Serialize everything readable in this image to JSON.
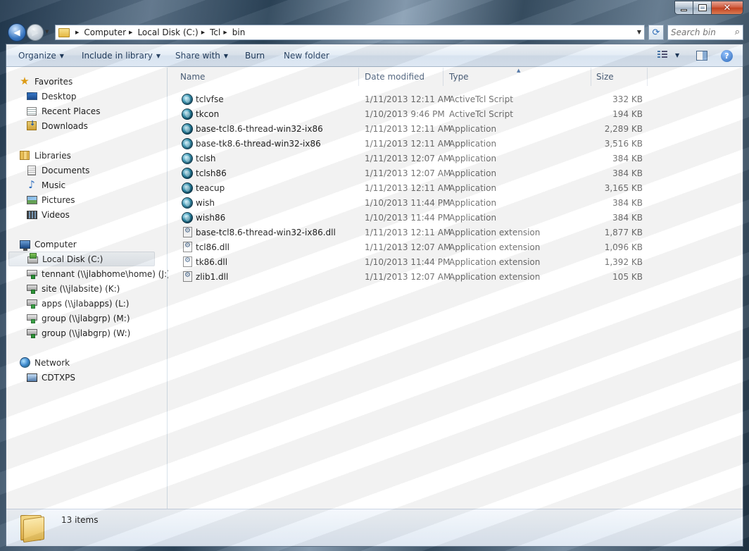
{
  "window": {
    "caption_buttons": {
      "minimize": "minimize-icon",
      "maximize": "maximize-icon",
      "close": "close-icon"
    }
  },
  "address": {
    "crumbs": [
      "Computer",
      "Local Disk (C:)",
      "Tcl",
      "bin"
    ]
  },
  "search": {
    "placeholder": "Search bin"
  },
  "toolbar": {
    "organize": "Organize",
    "include_in_library": "Include in library",
    "share_with": "Share with",
    "burn": "Burn",
    "new_folder": "New folder"
  },
  "nav": {
    "favorites": {
      "label": "Favorites",
      "items": [
        "Desktop",
        "Recent Places",
        "Downloads"
      ]
    },
    "libraries": {
      "label": "Libraries",
      "items": [
        "Documents",
        "Music",
        "Pictures",
        "Videos"
      ]
    },
    "computer": {
      "label": "Computer",
      "items": [
        "Local Disk (C:)",
        "tennant (\\\\jlabhome\\home) (J:)",
        "site (\\\\jlabsite) (K:)",
        "apps (\\\\jlabapps) (L:)",
        "group (\\\\jlabgrp) (M:)",
        "group (\\\\jlabgrp) (W:)"
      ],
      "selected": "Local Disk (C:)"
    },
    "network": {
      "label": "Network",
      "items": [
        "CDTXPS"
      ]
    }
  },
  "columns": {
    "name": "Name",
    "date": "Date modified",
    "type": "Type",
    "size": "Size"
  },
  "files": [
    {
      "name": "tclvfse",
      "date": "1/11/2013 12:11 AM",
      "type": "ActiveTcl Script",
      "size": "332 KB",
      "icon": "tcl"
    },
    {
      "name": "tkcon",
      "date": "1/10/2013 9:46 PM",
      "type": "ActiveTcl Script",
      "size": "194 KB",
      "icon": "tcl"
    },
    {
      "name": "base-tcl8.6-thread-win32-ix86",
      "date": "1/11/2013 12:11 AM",
      "type": "Application",
      "size": "2,289 KB",
      "icon": "tcl"
    },
    {
      "name": "base-tk8.6-thread-win32-ix86",
      "date": "1/11/2013 12:11 AM",
      "type": "Application",
      "size": "3,516 KB",
      "icon": "tcl"
    },
    {
      "name": "tclsh",
      "date": "1/11/2013 12:07 AM",
      "type": "Application",
      "size": "384 KB",
      "icon": "tcl"
    },
    {
      "name": "tclsh86",
      "date": "1/11/2013 12:07 AM",
      "type": "Application",
      "size": "384 KB",
      "icon": "tcl"
    },
    {
      "name": "teacup",
      "date": "1/11/2013 12:11 AM",
      "type": "Application",
      "size": "3,165 KB",
      "icon": "tcl"
    },
    {
      "name": "wish",
      "date": "1/10/2013 11:44 PM",
      "type": "Application",
      "size": "384 KB",
      "icon": "tcl"
    },
    {
      "name": "wish86",
      "date": "1/10/2013 11:44 PM",
      "type": "Application",
      "size": "384 KB",
      "icon": "tcl"
    },
    {
      "name": "base-tcl8.6-thread-win32-ix86.dll",
      "date": "1/11/2013 12:11 AM",
      "type": "Application extension",
      "size": "1,877 KB",
      "icon": "dll"
    },
    {
      "name": "tcl86.dll",
      "date": "1/11/2013 12:07 AM",
      "type": "Application extension",
      "size": "1,096 KB",
      "icon": "dll"
    },
    {
      "name": "tk86.dll",
      "date": "1/10/2013 11:44 PM",
      "type": "Application extension",
      "size": "1,392 KB",
      "icon": "dll"
    },
    {
      "name": "zlib1.dll",
      "date": "1/11/2013 12:07 AM",
      "type": "Application extension",
      "size": "105 KB",
      "icon": "dll"
    }
  ],
  "status": {
    "count": "13 items"
  }
}
